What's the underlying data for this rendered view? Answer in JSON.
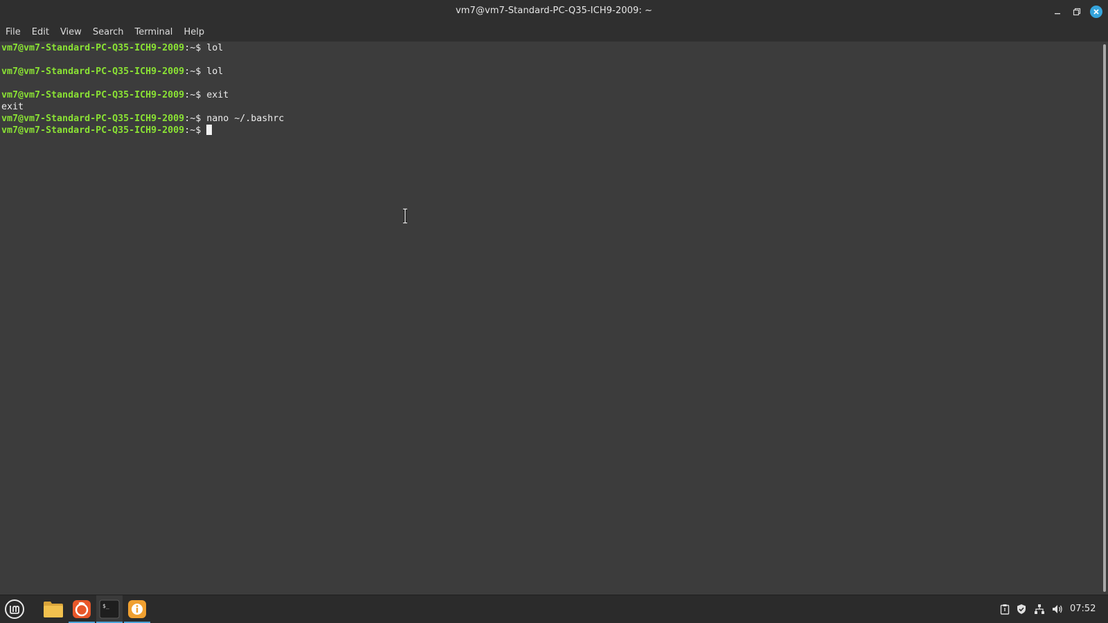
{
  "window": {
    "title": "vm7@vm7-Standard-PC-Q35-ICH9-2009: ~"
  },
  "menu": [
    "File",
    "Edit",
    "View",
    "Search",
    "Terminal",
    "Help"
  ],
  "terminal": {
    "prompt_user": "vm7@vm7-Standard-PC-Q35-ICH9-2009",
    "prompt_sep": ":~$ ",
    "lines": [
      {
        "type": "prompt",
        "cmd": "lol"
      },
      {
        "type": "blank"
      },
      {
        "type": "prompt",
        "cmd": "lol"
      },
      {
        "type": "blank"
      },
      {
        "type": "prompt",
        "cmd": "exit"
      },
      {
        "type": "output",
        "text": "exit"
      },
      {
        "type": "prompt",
        "cmd": "nano ~/.bashrc"
      },
      {
        "type": "prompt",
        "cmd": "",
        "cursor": true
      }
    ]
  },
  "taskbar": {
    "apps": [
      {
        "name": "menu",
        "icon": "linux-mint-logo-icon"
      },
      {
        "name": "files",
        "icon": "folder-icon"
      },
      {
        "name": "firefox",
        "icon": "firefox-icon"
      },
      {
        "name": "terminal",
        "icon": "terminal-icon"
      },
      {
        "name": "info",
        "icon": "info-icon"
      }
    ],
    "tray": [
      "clipboard-icon",
      "shield-icon",
      "network-icon",
      "volume-icon"
    ],
    "clock": "07:52"
  },
  "colors": {
    "prompt": "#8ae234",
    "background": "#3c3c3c",
    "accent": "#35a4dc"
  }
}
